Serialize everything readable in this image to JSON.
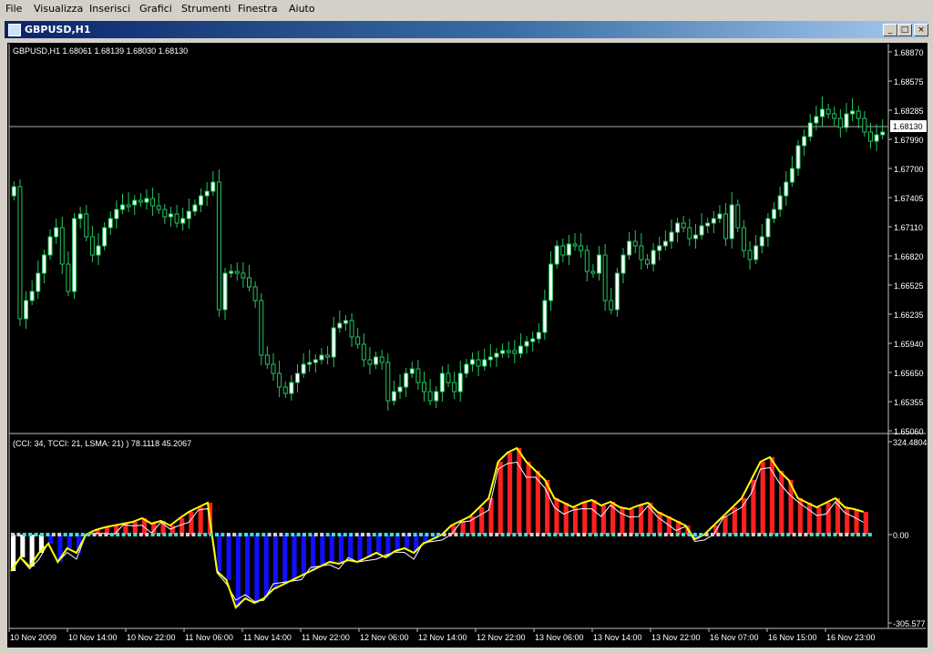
{
  "menu": [
    "File",
    "Visualizza",
    "Inserisci",
    "Grafici",
    "Strumenti",
    "Finestra",
    "Aiuto"
  ],
  "window": {
    "title": "GBPUSD,H1",
    "buttons": {
      "minimize": "_",
      "maximize": "□",
      "close": "×"
    }
  },
  "colors": {
    "background": "#000000",
    "bull_candle": "#ffffff",
    "wick": "#22c55e",
    "cci_positive": "#ff2020",
    "cci_negative": "#1010ff",
    "cci_neutral": "#ffffff",
    "trend_line": "#ffff00",
    "zero_dots_a": "#40e0d0",
    "zero_dots_b": "#d0d0d0"
  },
  "price_panel": {
    "header": "GBPUSD,H1  1.68061 1.68139 1.68030 1.68130",
    "current_price": "1.68130",
    "axis_labels": [
      "1.68870",
      "1.68575",
      "1.68285",
      "1.67990",
      "1.67700",
      "1.67405",
      "1.67110",
      "1.66820",
      "1.66525",
      "1.66235",
      "1.65940",
      "1.65650",
      "1.65355",
      "1.65060"
    ]
  },
  "indicator_panel": {
    "header": "(CCI: 34, TCCI: 21, LSMA: 21) )  78.1118 45.2067",
    "axis_top": "324.4804",
    "axis_zero": "0.00",
    "axis_bottom": "-305.577"
  },
  "time_labels": [
    "10 Nov 2009",
    "10 Nov 14:00",
    "10 Nov 22:00",
    "11 Nov 06:00",
    "11 Nov 14:00",
    "11 Nov 22:00",
    "12 Nov 06:00",
    "12 Nov 14:00",
    "12 Nov 22:00",
    "13 Nov 06:00",
    "13 Nov 14:00",
    "13 Nov 22:00",
    "16 Nov 07:00",
    "16 Nov 15:00",
    "16 Nov 23:00"
  ]
}
